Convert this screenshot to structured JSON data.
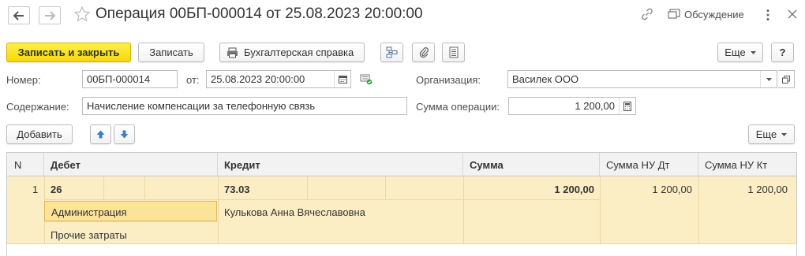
{
  "window": {
    "title": "Операция 00БП-000014 от 25.08.2023 20:00:00",
    "discuss_label": "Обсуждение"
  },
  "toolbar": {
    "save_close_label": "Записать и закрыть",
    "save_label": "Записать",
    "report_label": "Бухгалтерская справка",
    "more_label": "Еще",
    "help_label": "?"
  },
  "form": {
    "number_label": "Номер:",
    "number_value": "00БП-000014",
    "date_label": "от:",
    "date_value": "25.08.2023 20:00:00",
    "org_label": "Организация:",
    "org_value": "Василек ООО",
    "content_label": "Содержание:",
    "content_value": "Начисление компенсации за телефонную связь",
    "sum_label": "Сумма операции:",
    "sum_value": "1 200,00"
  },
  "table_toolbar": {
    "add_label": "Добавить",
    "more_label": "Еще"
  },
  "table": {
    "headers": {
      "n": "N",
      "debit": "Дебет",
      "credit": "Кредит",
      "sum": "Сумма",
      "sum_nu_dt": "Сумма НУ Дт",
      "sum_nu_kt": "Сумма НУ Кт"
    },
    "rows": [
      {
        "n": "1",
        "debit_account": "26",
        "debit_subconto1": "Администрация",
        "debit_subconto2": "Прочие затраты",
        "credit_account": "73.03",
        "credit_subconto1": "Кулькова Анна Вячеславовна",
        "sum": "1 200,00",
        "sum_nu_dt": "1 200,00",
        "sum_nu_kt": "1 200,00"
      }
    ]
  }
}
